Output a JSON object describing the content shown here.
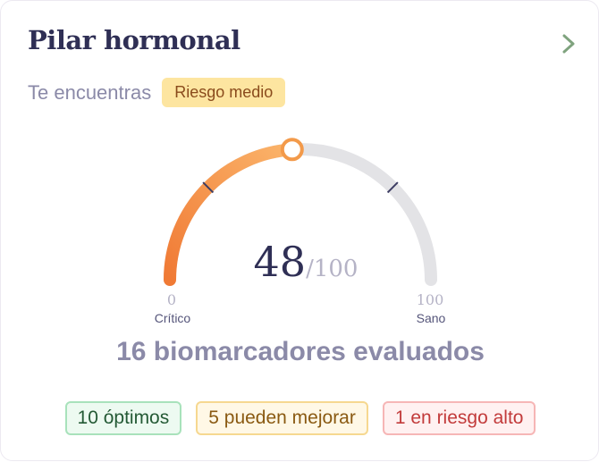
{
  "card": {
    "title": "Pilar hormonal",
    "chevron_icon": "chevron-right-icon"
  },
  "status": {
    "label": "Te encuentras",
    "badge": "Riesgo medio",
    "badge_color": "#fde5a0"
  },
  "gauge": {
    "value": 48,
    "value_text": "48",
    "max_text": "/100",
    "min": 0,
    "max": 100,
    "min_label": "0",
    "max_label": "100",
    "min_caption": "Crítico",
    "max_caption": "Sano",
    "colors": {
      "fill_start": "#f07a35",
      "fill_end": "#fbb46a",
      "track": "#e3e3e6",
      "marker": "#f39a4a"
    }
  },
  "summary": {
    "text": "16 biomarcadores evaluados"
  },
  "pills": [
    {
      "label": "10 óptimos",
      "color": "#245a35"
    },
    {
      "label": "5 pueden mejorar",
      "color": "#8a5a12"
    },
    {
      "label": "1 en riesgo alto",
      "color": "#c23b3b"
    }
  ]
}
